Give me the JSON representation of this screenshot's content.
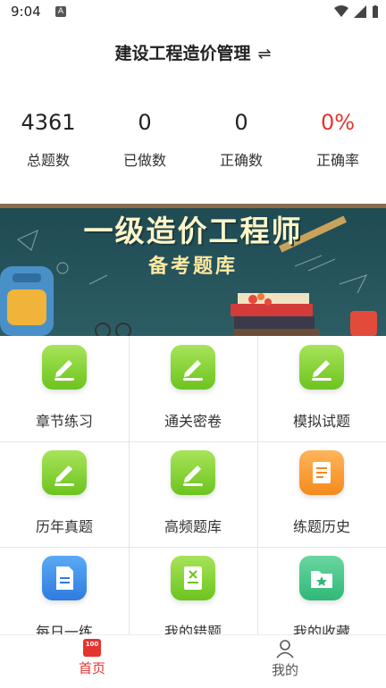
{
  "status_bar": {
    "time": "9:04",
    "notification_badge": "A"
  },
  "header": {
    "title": "建设工程造价管理",
    "switch_icon": "⇌"
  },
  "stats": [
    {
      "value": "4361",
      "label": "总题数",
      "color": "#222222"
    },
    {
      "value": "0",
      "label": "已做数",
      "color": "#222222"
    },
    {
      "value": "0",
      "label": "正确数",
      "color": "#222222"
    },
    {
      "value": "0%",
      "label": "正确率",
      "color": "#e5342f"
    }
  ],
  "banner": {
    "title": "一级造价工程师",
    "subtitle": "备考题库"
  },
  "menu": [
    {
      "label": "章节练习",
      "icon": "pencil-icon",
      "color": "green"
    },
    {
      "label": "通关密卷",
      "icon": "pencil-icon",
      "color": "green"
    },
    {
      "label": "模拟试题",
      "icon": "pencil-icon",
      "color": "green"
    },
    {
      "label": "历年真题",
      "icon": "pencil-icon",
      "color": "green"
    },
    {
      "label": "高频题库",
      "icon": "pencil-icon",
      "color": "green"
    },
    {
      "label": "练题历史",
      "icon": "scroll-icon",
      "color": "orange"
    },
    {
      "label": "每日一练",
      "icon": "document-icon",
      "color": "blue"
    },
    {
      "label": "我的错题",
      "icon": "wrong-book-icon",
      "color": "green"
    },
    {
      "label": "我的收藏",
      "icon": "star-folder-icon",
      "color": "teal"
    }
  ],
  "tabbar": {
    "home_label": "首页",
    "home_badge": "100",
    "mine_label": "我的",
    "active_color": "#e5342f",
    "inactive_color": "#555555"
  }
}
